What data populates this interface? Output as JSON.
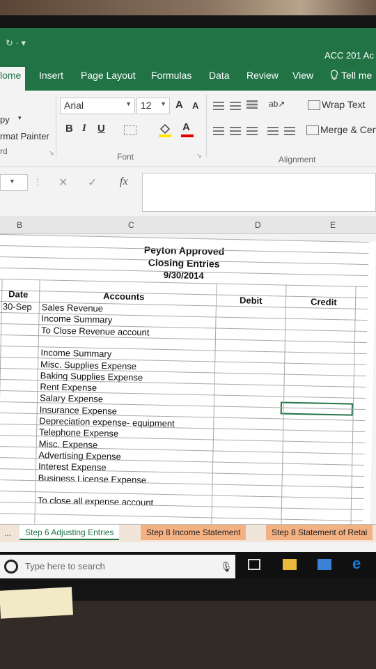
{
  "app": {
    "title": "ACC 201 Ac",
    "qat_glyph": "↻ · ▾"
  },
  "ribbon_tabs": [
    {
      "label": "lome",
      "active": true
    },
    {
      "label": "Insert"
    },
    {
      "label": "Page Layout"
    },
    {
      "label": "Formulas"
    },
    {
      "label": "Data"
    },
    {
      "label": "Review"
    },
    {
      "label": "View"
    },
    {
      "label": "Tell me"
    }
  ],
  "clipboard": {
    "copy_label": "py",
    "format_painter_label": "rmat Painter",
    "group_label": "rd"
  },
  "font": {
    "name": "Arial",
    "size": "12",
    "grow_label": "A",
    "shrink_label": "A",
    "bold_label": "B",
    "italic_label": "I",
    "underline_label": "U",
    "font_color_label": "A",
    "group_label": "Font",
    "highlight_color": "#ffe600",
    "font_color": "#e00000"
  },
  "alignment": {
    "wrap_text_label": "Wrap Text",
    "merge_label": "Merge & Cen",
    "group_label": "Alignment",
    "orientation_glyph": "ab↗"
  },
  "formula_bar": {
    "cancel": "✕",
    "enter": "✓",
    "fx": "fx",
    "content": ""
  },
  "columns": [
    "B",
    "C",
    "D",
    "E"
  ],
  "sheet": {
    "company": "Peyton Approved",
    "title": "Closing Entries",
    "date": "9/30/2014",
    "headers": {
      "date": "Date",
      "accounts": "Accounts",
      "debit": "Debit",
      "credit": "Credit"
    },
    "entry_date": "30-Sep",
    "rows": [
      "Sales Revenue",
      "Income Summary",
      "To Close Revenue account",
      "",
      "Income Summary",
      "Misc. Supplies Expense",
      "Baking Supplies Expense",
      "Rent Expense",
      "Salary Expense",
      "Insurance Expense",
      "Depreciation expense- equipment",
      "Telephone Expense",
      "Misc. Expense",
      "Advertising Expense",
      "Interest Expense",
      "Business License Expense",
      "",
      "To close all expense account"
    ]
  },
  "sheet_tabs": [
    {
      "label": "...",
      "kind": "nav"
    },
    {
      "label": "Step 6 Adjusting Entries",
      "kind": "normal"
    },
    {
      "label": "Step 8 Income Statement",
      "kind": "colored"
    },
    {
      "label": "Step 8 Statement of Retai",
      "kind": "colored"
    }
  ],
  "taskbar": {
    "search_placeholder": "Type here to search",
    "edge_color": "#1e7ad6",
    "explorer_color": "#e9b93b",
    "store_color": "#3a82d6"
  },
  "colors": {
    "excel_green": "#217346"
  }
}
